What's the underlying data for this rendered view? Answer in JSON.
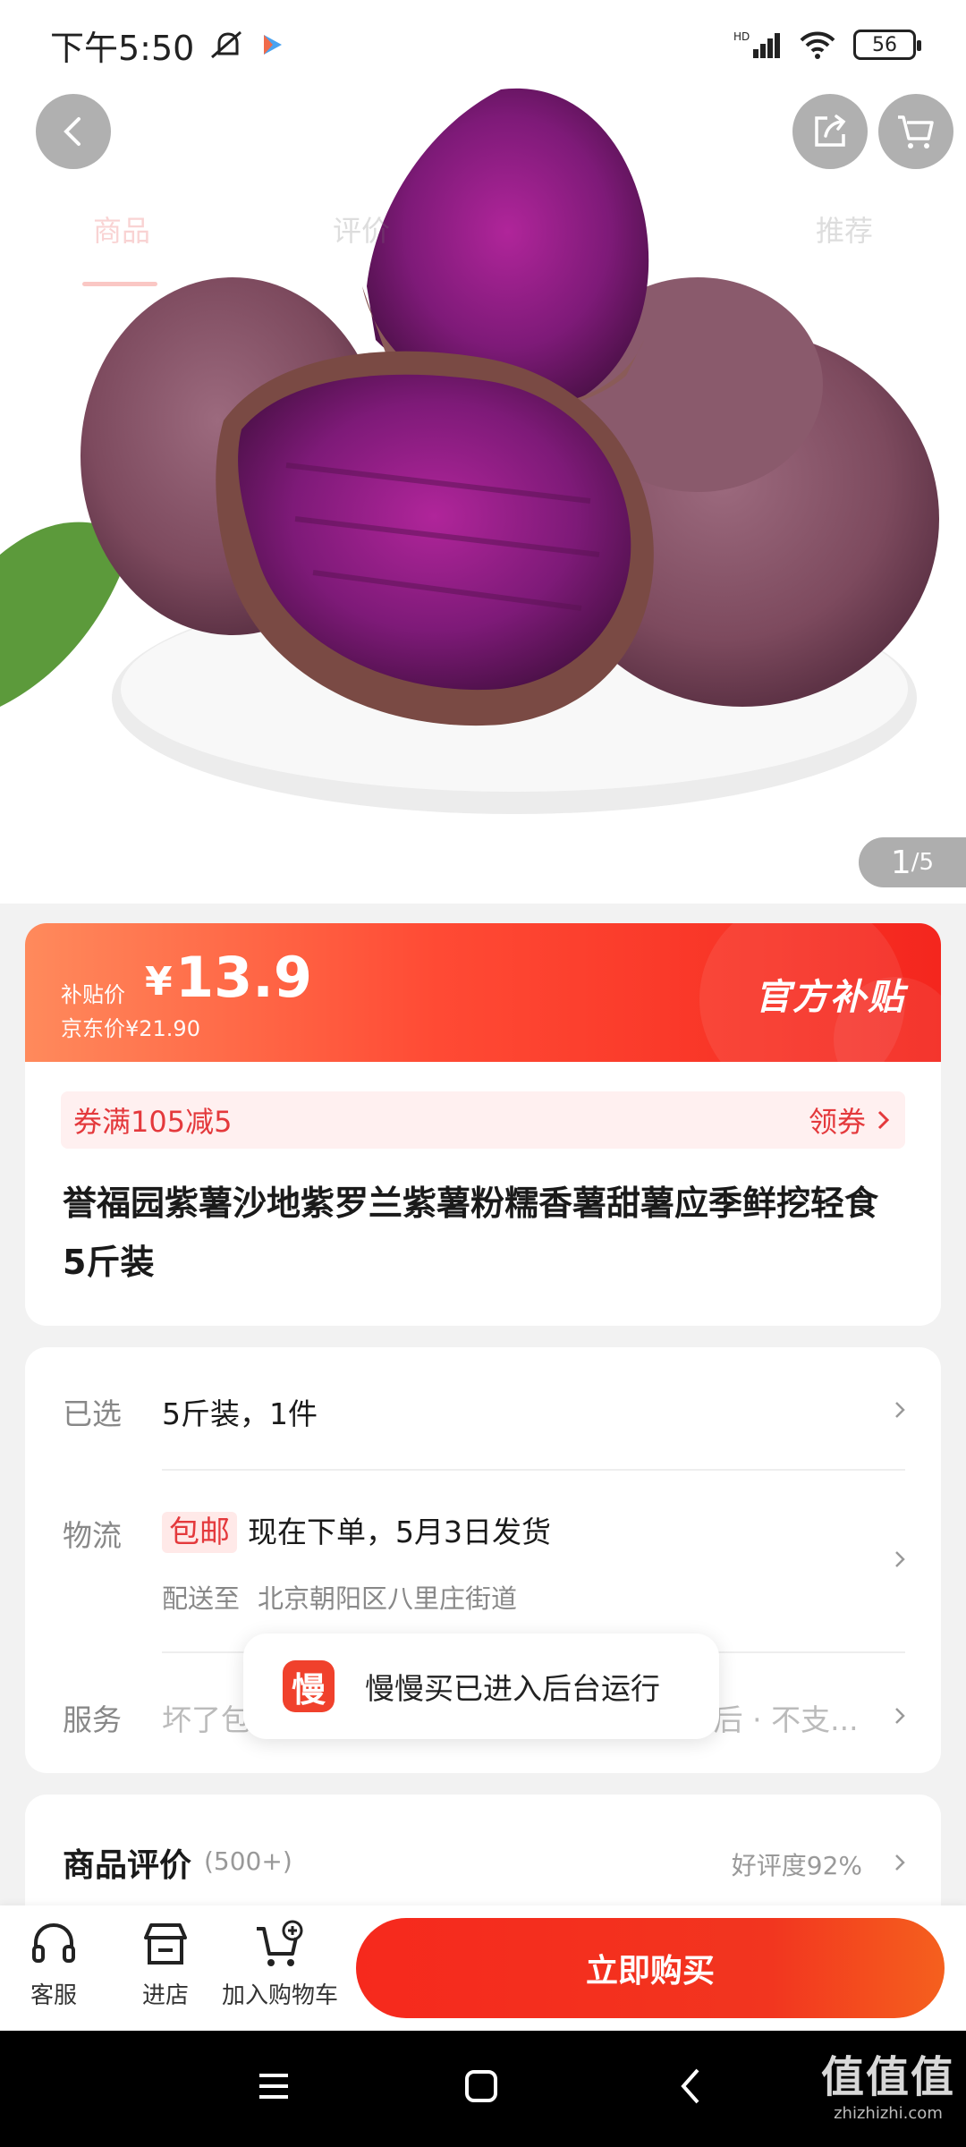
{
  "status_bar": {
    "time": "下午5:50",
    "network": "HD",
    "battery": "56"
  },
  "hero": {
    "tabs": [
      "商品",
      "评价",
      "推荐"
    ],
    "header_title": "商品",
    "counter_current": "1",
    "counter_total": "/5"
  },
  "price": {
    "label": "补贴价",
    "currency": "¥",
    "value": "13.9",
    "original": "京东价¥21.90",
    "badge": "官方补贴"
  },
  "coupon": {
    "text": "券满105减5",
    "action": "领券"
  },
  "product": {
    "title": "誉福园紫薯沙地紫罗兰紫薯粉糯香薯甜薯应季鲜挖轻食 5斤装"
  },
  "selection": {
    "selected_label": "已选",
    "selected_value": "5斤装，1件",
    "shipping_label": "物流",
    "shipping_badge": "包邮",
    "shipping_text": "现在下单，5月3日发货",
    "deliver_prefix": "配送至",
    "deliver_address": "北京朝阳区八里庄街道",
    "service_label": "服务",
    "service_text": "坏了包赔 · 七天无理由退货 · 商家发货&售后 · 不支..."
  },
  "toast": {
    "icon_text": "慢",
    "text": "慢慢买已进入后台运行"
  },
  "reviews": {
    "title": "商品评价",
    "count": "(500+)",
    "rate": "好评度92%"
  },
  "action_bar": {
    "service": "客服",
    "store": "进店",
    "cart": "加入购物车",
    "buy": "立即购买"
  },
  "watermark": {
    "big": "值值值",
    "small": "zhizhizhi.com"
  },
  "colors": {
    "accent": "#e4393c",
    "buy_button": "#f52d1e",
    "banner_start": "#ff8a5c"
  }
}
